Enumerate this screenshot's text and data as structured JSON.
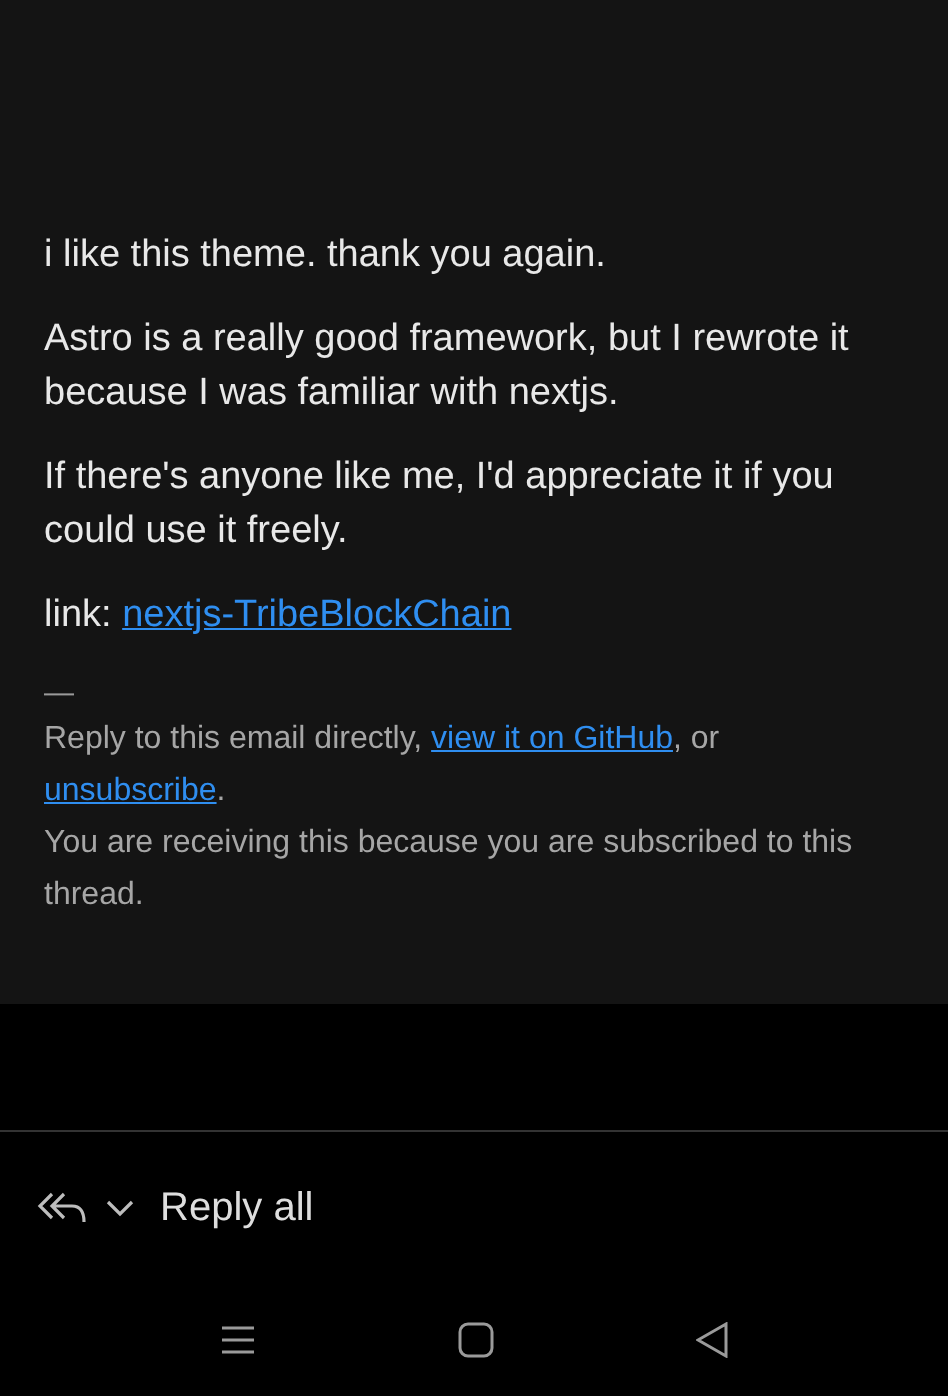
{
  "message": {
    "paragraphs": [
      "i like this theme. thank you again.",
      "Astro is a really good framework, but I rewrote it because I was familiar with nextjs.",
      "If there's anyone like me, I'd appreciate it if you could use it freely."
    ],
    "link_line": {
      "label": "link:",
      "link": "nextjs-TribeBlockChain"
    },
    "signature_dash": "—",
    "footer": [
      {
        "kind": "text",
        "text": "Reply to this email directly, "
      },
      {
        "kind": "link",
        "text": "view it on GitHub"
      },
      {
        "kind": "text",
        "text": ", or "
      },
      {
        "kind": "link",
        "text": "unsubscribe"
      },
      {
        "kind": "text",
        "text": "."
      }
    ],
    "notice": "You are receiving this because you are subscribed to this thread."
  },
  "reply_bar": {
    "label": "Reply all"
  }
}
